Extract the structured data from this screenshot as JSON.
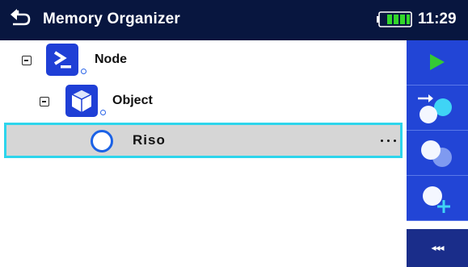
{
  "header": {
    "title": "Memory Organizer",
    "time": "11:29",
    "back_icon": "back-arrow-icon",
    "battery_icon": "battery-icon"
  },
  "tree": {
    "items": [
      {
        "label": "Node",
        "icon": "terminal-prompt-icon",
        "expanded": true
      },
      {
        "label": "Object",
        "icon": "cube-icon",
        "expanded": true
      },
      {
        "label": "Riso",
        "icon": "measurement-circle-icon",
        "selected": true,
        "more_icon": "ellipsis-icon"
      }
    ]
  },
  "sidebar": {
    "buttons": [
      {
        "icon": "play-icon"
      },
      {
        "icon": "move-to-icon"
      },
      {
        "icon": "clone-icon"
      },
      {
        "icon": "add-measurement-icon"
      }
    ],
    "collapse_label": "◂◂◂"
  },
  "colors": {
    "header_bg": "#08163f",
    "sidebar_bg": "#2245d6",
    "selection_border": "#2dd5ec",
    "accent_blue": "#1f3fd6",
    "play_green": "#34c934"
  }
}
